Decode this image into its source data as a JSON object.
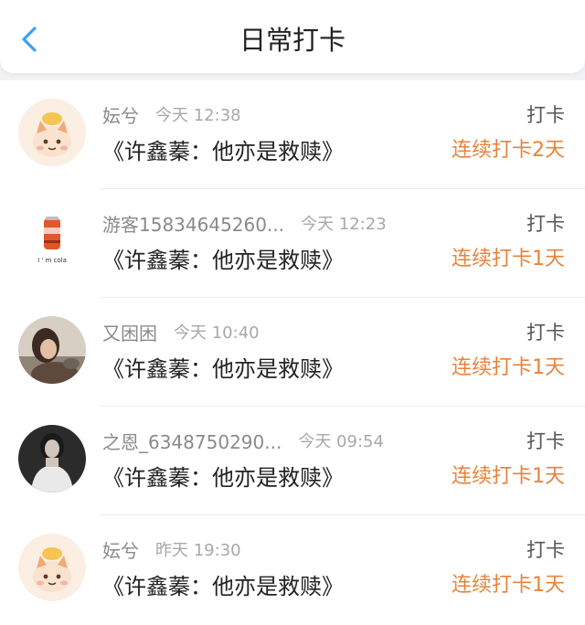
{
  "header": {
    "title": "日常打卡",
    "back_icon": "chevron-left-icon",
    "accent_color": "#3da1ef"
  },
  "streak_color": "#e8823b",
  "records": [
    {
      "name": "妘兮",
      "time": "今天 12:38",
      "content": "《许鑫蓁：他亦是救赎》",
      "action": "打卡",
      "streak": "连续打卡2天",
      "avatar": "cartoon-cat-avatar"
    },
    {
      "name": "游客15834645260...",
      "time": "今天 12:23",
      "content": "《许鑫蓁：他亦是救赎》",
      "action": "打卡",
      "streak": "连续打卡1天",
      "avatar": "soda-can-avatar",
      "avatar_caption": "I ' m cola"
    },
    {
      "name": "又困困",
      "time": "今天 10:40",
      "content": "《许鑫蓁：他亦是救赎》",
      "action": "打卡",
      "streak": "连续打卡1天",
      "avatar": "photo-avatar"
    },
    {
      "name": "之恩_6348750290...",
      "time": "今天 09:54",
      "content": "《许鑫蓁：他亦是救赎》",
      "action": "打卡",
      "streak": "连续打卡1天",
      "avatar": "photo-avatar"
    },
    {
      "name": "妘兮",
      "time": "昨天 19:30",
      "content": "《许鑫蓁：他亦是救赎》",
      "action": "打卡",
      "streak": "连续打卡1天",
      "avatar": "cartoon-cat-avatar"
    }
  ]
}
